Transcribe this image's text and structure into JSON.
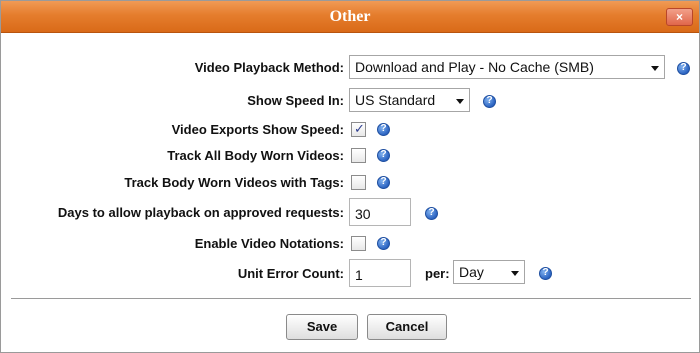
{
  "dialog": {
    "title": "Other",
    "close_label": "×"
  },
  "form": {
    "video_playback_method": {
      "label": "Video Playback Method:",
      "value": "Download and Play - No Cache (SMB)"
    },
    "show_speed_in": {
      "label": "Show Speed In:",
      "value": "US Standard"
    },
    "video_exports_show_speed": {
      "label": "Video Exports Show Speed:",
      "checked": true
    },
    "track_all_body_worn": {
      "label": "Track All Body Worn Videos:",
      "checked": false
    },
    "track_body_worn_tags": {
      "label": "Track Body Worn Videos with Tags:",
      "checked": false
    },
    "days_playback": {
      "label": "Days to allow playback on approved requests:",
      "value": "30"
    },
    "enable_video_notations": {
      "label": "Enable Video Notations:",
      "checked": false
    },
    "unit_error_count": {
      "label": "Unit Error Count:",
      "value": "1",
      "per_label": "per:",
      "per_value": "Day"
    }
  },
  "help_glyph": "?",
  "check_glyph": "✓",
  "buttons": {
    "save": "Save",
    "cancel": "Cancel"
  },
  "colors": {
    "titlebar": "#e57d2d",
    "help_icon": "#2c64c2"
  },
  "icons": {
    "help": "help-icon",
    "close": "close-icon"
  }
}
